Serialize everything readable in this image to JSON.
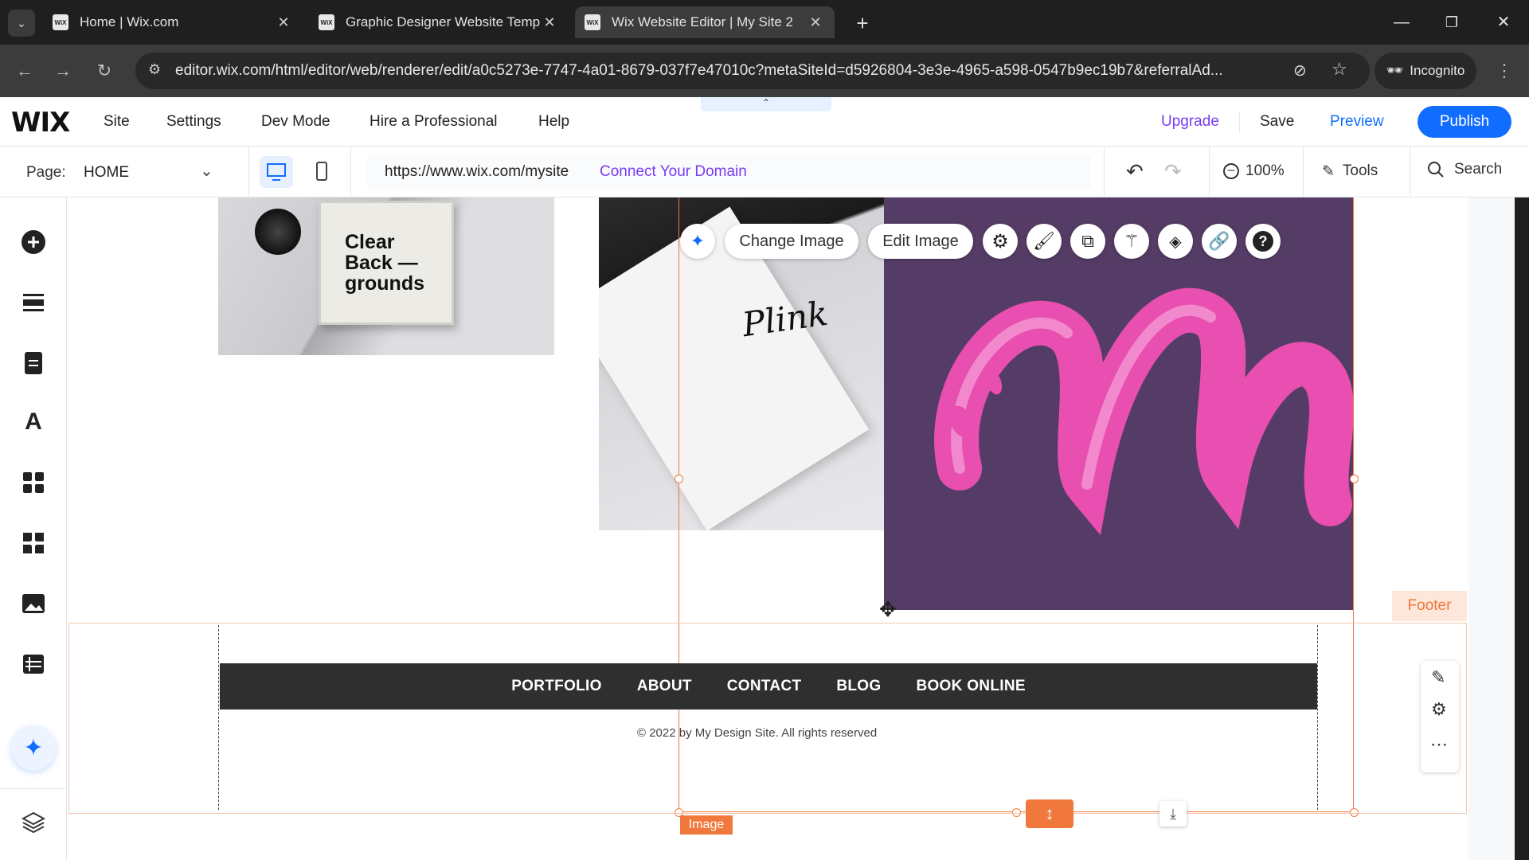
{
  "browser": {
    "tabs": [
      {
        "title": "Home | Wix.com",
        "favicon": "WiX"
      },
      {
        "title": "Graphic Designer Website Temp",
        "favicon": "WiX"
      },
      {
        "title": "Wix Website Editor | My Site 2",
        "favicon": "WiX"
      }
    ],
    "url": "editor.wix.com/html/editor/web/renderer/edit/a0c5273e-7747-4a01-8679-037f7e47010c?metaSiteId=d5926804-3e3e-4965-a598-0547b9ec19b7&referralAd...",
    "incognito_label": "Incognito"
  },
  "wix_topbar": {
    "logo": "WIX",
    "menu": [
      "Site",
      "Settings",
      "Dev Mode",
      "Hire a Professional",
      "Help"
    ],
    "upgrade": "Upgrade",
    "save": "Save",
    "preview": "Preview",
    "publish": "Publish"
  },
  "pagebar": {
    "page_label": "Page:",
    "page_value": "HOME",
    "site_url": "https://www.wix.com/mysite",
    "connect_domain": "Connect Your Domain",
    "zoom": "100%",
    "tools": "Tools",
    "search": "Search"
  },
  "image_toolbar": {
    "change_image": "Change Image",
    "edit_image": "Edit Image"
  },
  "canvas": {
    "cd_cover_text": "Clear Back — grounds",
    "notebook_text": "Plink",
    "footer_tag": "Footer",
    "footer_nav": [
      "PORTFOLIO",
      "ABOUT",
      "CONTACT",
      "BLOG",
      "BOOK ONLINE"
    ],
    "copyright": "© 2022 by My Design Site. All rights reserved",
    "selection_label": "Image"
  },
  "colors": {
    "accent": "#116dff",
    "connect_domain": "#7a3cf0",
    "upgrade": "#7a3cf0",
    "selection": "#f0783c",
    "purple_bg": "#553c66",
    "pink": "#e84fb0"
  }
}
